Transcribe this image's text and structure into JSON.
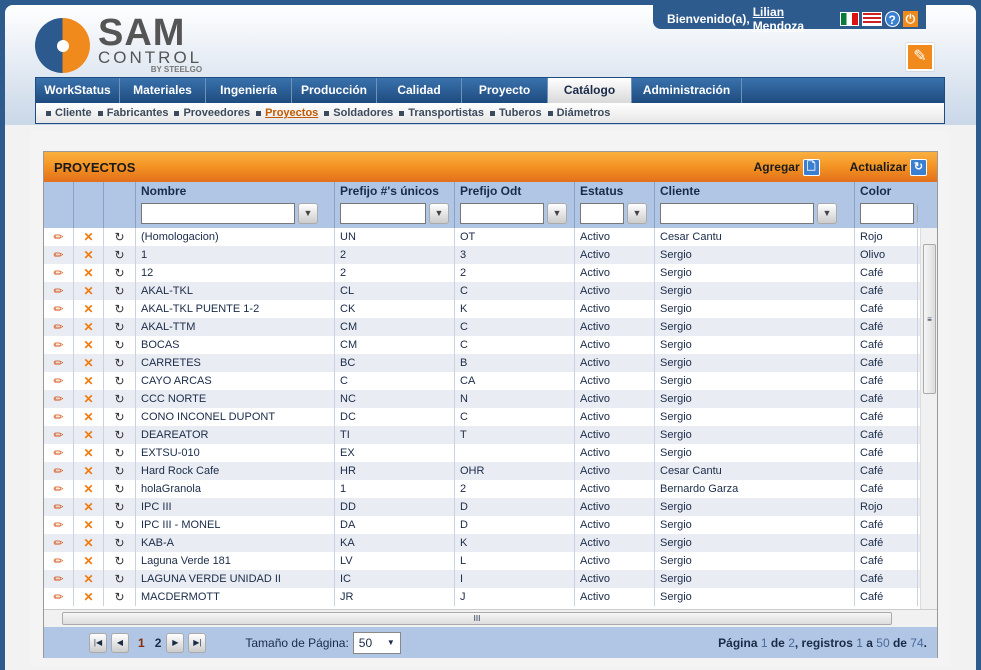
{
  "header": {
    "welcome": "Bienvenido(a),",
    "user": "Lilian Mendoza",
    "logo": {
      "brand": "SAM",
      "sub": "CONTROL",
      "by": "BY STEELGO"
    }
  },
  "nav": {
    "tabs": [
      "WorkStatus",
      "Materiales",
      "Ingeniería",
      "Producción",
      "Calidad",
      "Proyecto",
      "Catálogo",
      "Administración"
    ],
    "active": "Catálogo"
  },
  "subnav": {
    "items": [
      "Cliente",
      "Fabricantes",
      "Proveedores",
      "Proyectos",
      "Soldadores",
      "Transportistas",
      "Tuberos",
      "Diámetros"
    ],
    "active": "Proyectos"
  },
  "panel": {
    "title": "PROYECTOS",
    "add": "Agregar",
    "refresh": "Actualizar"
  },
  "columns": [
    "Nombre",
    "Prefijo #'s únicos",
    "Prefijo Odt",
    "Estatus",
    "Cliente",
    "Color"
  ],
  "rows": [
    [
      "(Homologacion)",
      "UN",
      "OT",
      "Activo",
      "Cesar Cantu",
      "Rojo"
    ],
    [
      "1",
      "2",
      "3",
      "Activo",
      "Sergio",
      "Olivo"
    ],
    [
      "12",
      "2",
      "2",
      "Activo",
      "Sergio",
      "Café"
    ],
    [
      "AKAL-TKL",
      "CL",
      "C",
      "Activo",
      "Sergio",
      "Café"
    ],
    [
      "AKAL-TKL PUENTE 1-2",
      "CK",
      "K",
      "Activo",
      "Sergio",
      "Café"
    ],
    [
      "AKAL-TTM",
      "CM",
      "C",
      "Activo",
      "Sergio",
      "Café"
    ],
    [
      "BOCAS",
      "CM",
      "C",
      "Activo",
      "Sergio",
      "Café"
    ],
    [
      "CARRETES",
      "BC",
      "B",
      "Activo",
      "Sergio",
      "Café"
    ],
    [
      "CAYO ARCAS",
      "C",
      "CA",
      "Activo",
      "Sergio",
      "Café"
    ],
    [
      "CCC NORTE",
      "NC",
      "N",
      "Activo",
      "Sergio",
      "Café"
    ],
    [
      "CONO INCONEL DUPONT",
      "DC",
      "C",
      "Activo",
      "Sergio",
      "Café"
    ],
    [
      "DEAREATOR",
      "TI",
      "T",
      "Activo",
      "Sergio",
      "Café"
    ],
    [
      "EXTSU-010",
      "EX",
      "",
      "Activo",
      "Sergio",
      "Café"
    ],
    [
      "Hard Rock Cafe",
      "HR",
      "OHR",
      "Activo",
      "Cesar Cantu",
      "Café"
    ],
    [
      "holaGranola",
      "1",
      "2",
      "Activo",
      "Bernardo Garza",
      "Café"
    ],
    [
      "IPC III",
      "DD",
      "D",
      "Activo",
      "Sergio",
      "Rojo"
    ],
    [
      "IPC III - MONEL",
      "DA",
      "D",
      "Activo",
      "Sergio",
      "Café"
    ],
    [
      "KAB-A",
      "KA",
      "K",
      "Activo",
      "Sergio",
      "Café"
    ],
    [
      "Laguna Verde 181",
      "LV",
      "L",
      "Activo",
      "Sergio",
      "Café"
    ],
    [
      "LAGUNA VERDE UNIDAD II",
      "IC",
      "I",
      "Activo",
      "Sergio",
      "Café"
    ],
    [
      "MACDERMOTT",
      "JR",
      "J",
      "Activo",
      "Sergio",
      "Café"
    ]
  ],
  "pager": {
    "pages": [
      "1",
      "2"
    ],
    "current": "1",
    "size_label": "Tamaño de Página:",
    "size": "50",
    "info": {
      "a": "Página ",
      "page": "1",
      "b": " de ",
      "pages": "2",
      "c": ", registros ",
      "from": "1",
      "d": " a ",
      "to": "50",
      "e": " de ",
      "total": "74",
      "f": "."
    }
  }
}
